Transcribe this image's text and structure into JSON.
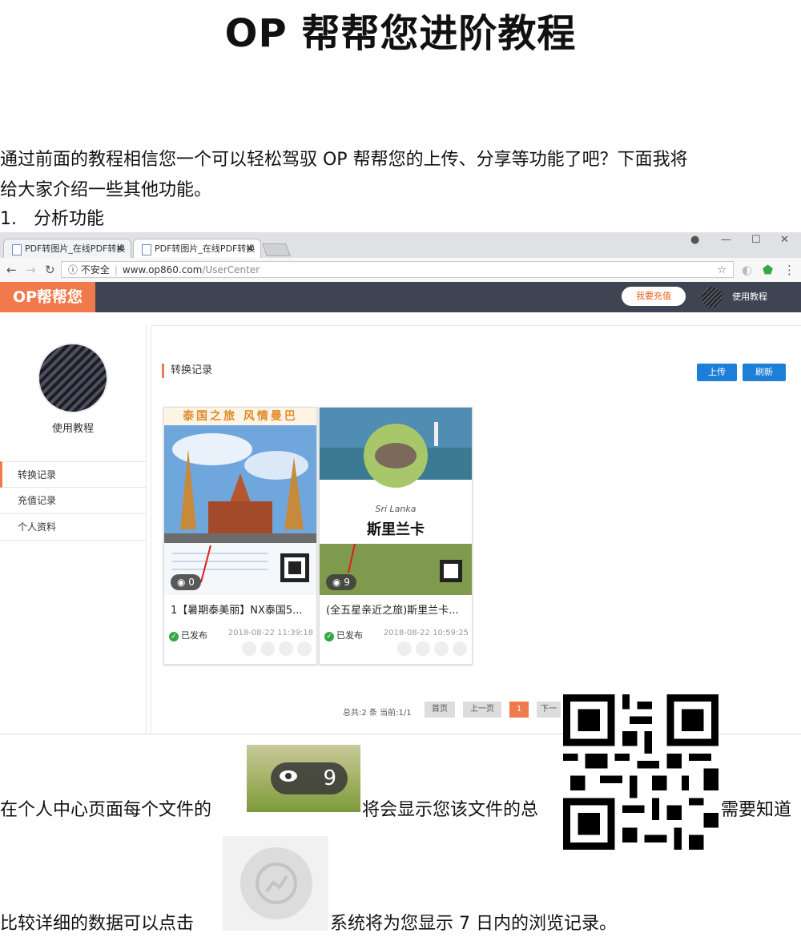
{
  "doc": {
    "title": "OP 帮帮您进阶教程",
    "intro_line1": "通过前面的教程相信您一个可以轻松驾驭 OP 帮帮您的上传、分享等功能了吧？下面我将",
    "intro_line2": "给大家介绍一些其他功能。",
    "section": "1.   分析功能",
    "para2_a": "在个人中心页面每个文件的",
    "para2_b": "将会显示您该文件的总",
    "para2_c": "需要知道",
    "para3_a": "比较详细的数据可以点击",
    "para3_b": "系统将为您显示 7 日内的浏览记录。",
    "chip_views": "9"
  },
  "browser": {
    "tabs": [
      {
        "label": "PDF转图片_在线PDF转换",
        "close": "✕"
      },
      {
        "label": "PDF转图片_在线PDF转换",
        "close": "✕"
      }
    ],
    "insecure": "不安全",
    "url_host": "www.op860.com",
    "url_path": "/UserCenter"
  },
  "app": {
    "logo": "OP帮帮您",
    "recharge": "我要充值",
    "user_link": "使用教程",
    "user_name": "使用教程",
    "menu": [
      "转换记录",
      "充值记录",
      "个人资料"
    ],
    "section_title": "转换记录",
    "upload": "上传",
    "refresh": "刷新",
    "cards": [
      {
        "title": "1【暑期泰美丽】NX泰国5...",
        "views": "0",
        "status": "已发布",
        "date": "2018-08-22 11:39:18",
        "banner": "泰国之旅 风情曼巴"
      },
      {
        "title": "(全五星亲近之旅)斯里兰卡...",
        "views": "9",
        "status": "已发布",
        "date": "2018-08-22 10:59:25",
        "banner": "斯里兰卡",
        "sub": "Sri Lanka"
      }
    ],
    "pager_info": "总共:2 条 当前:1/1",
    "pager": {
      "first": "首页",
      "prev": "上一页",
      "current": "1",
      "next": "下一"
    }
  },
  "colors": {
    "accent": "#f07a4b",
    "header": "#3f4453",
    "primary": "#1e7fd8",
    "ok": "#35a845"
  }
}
